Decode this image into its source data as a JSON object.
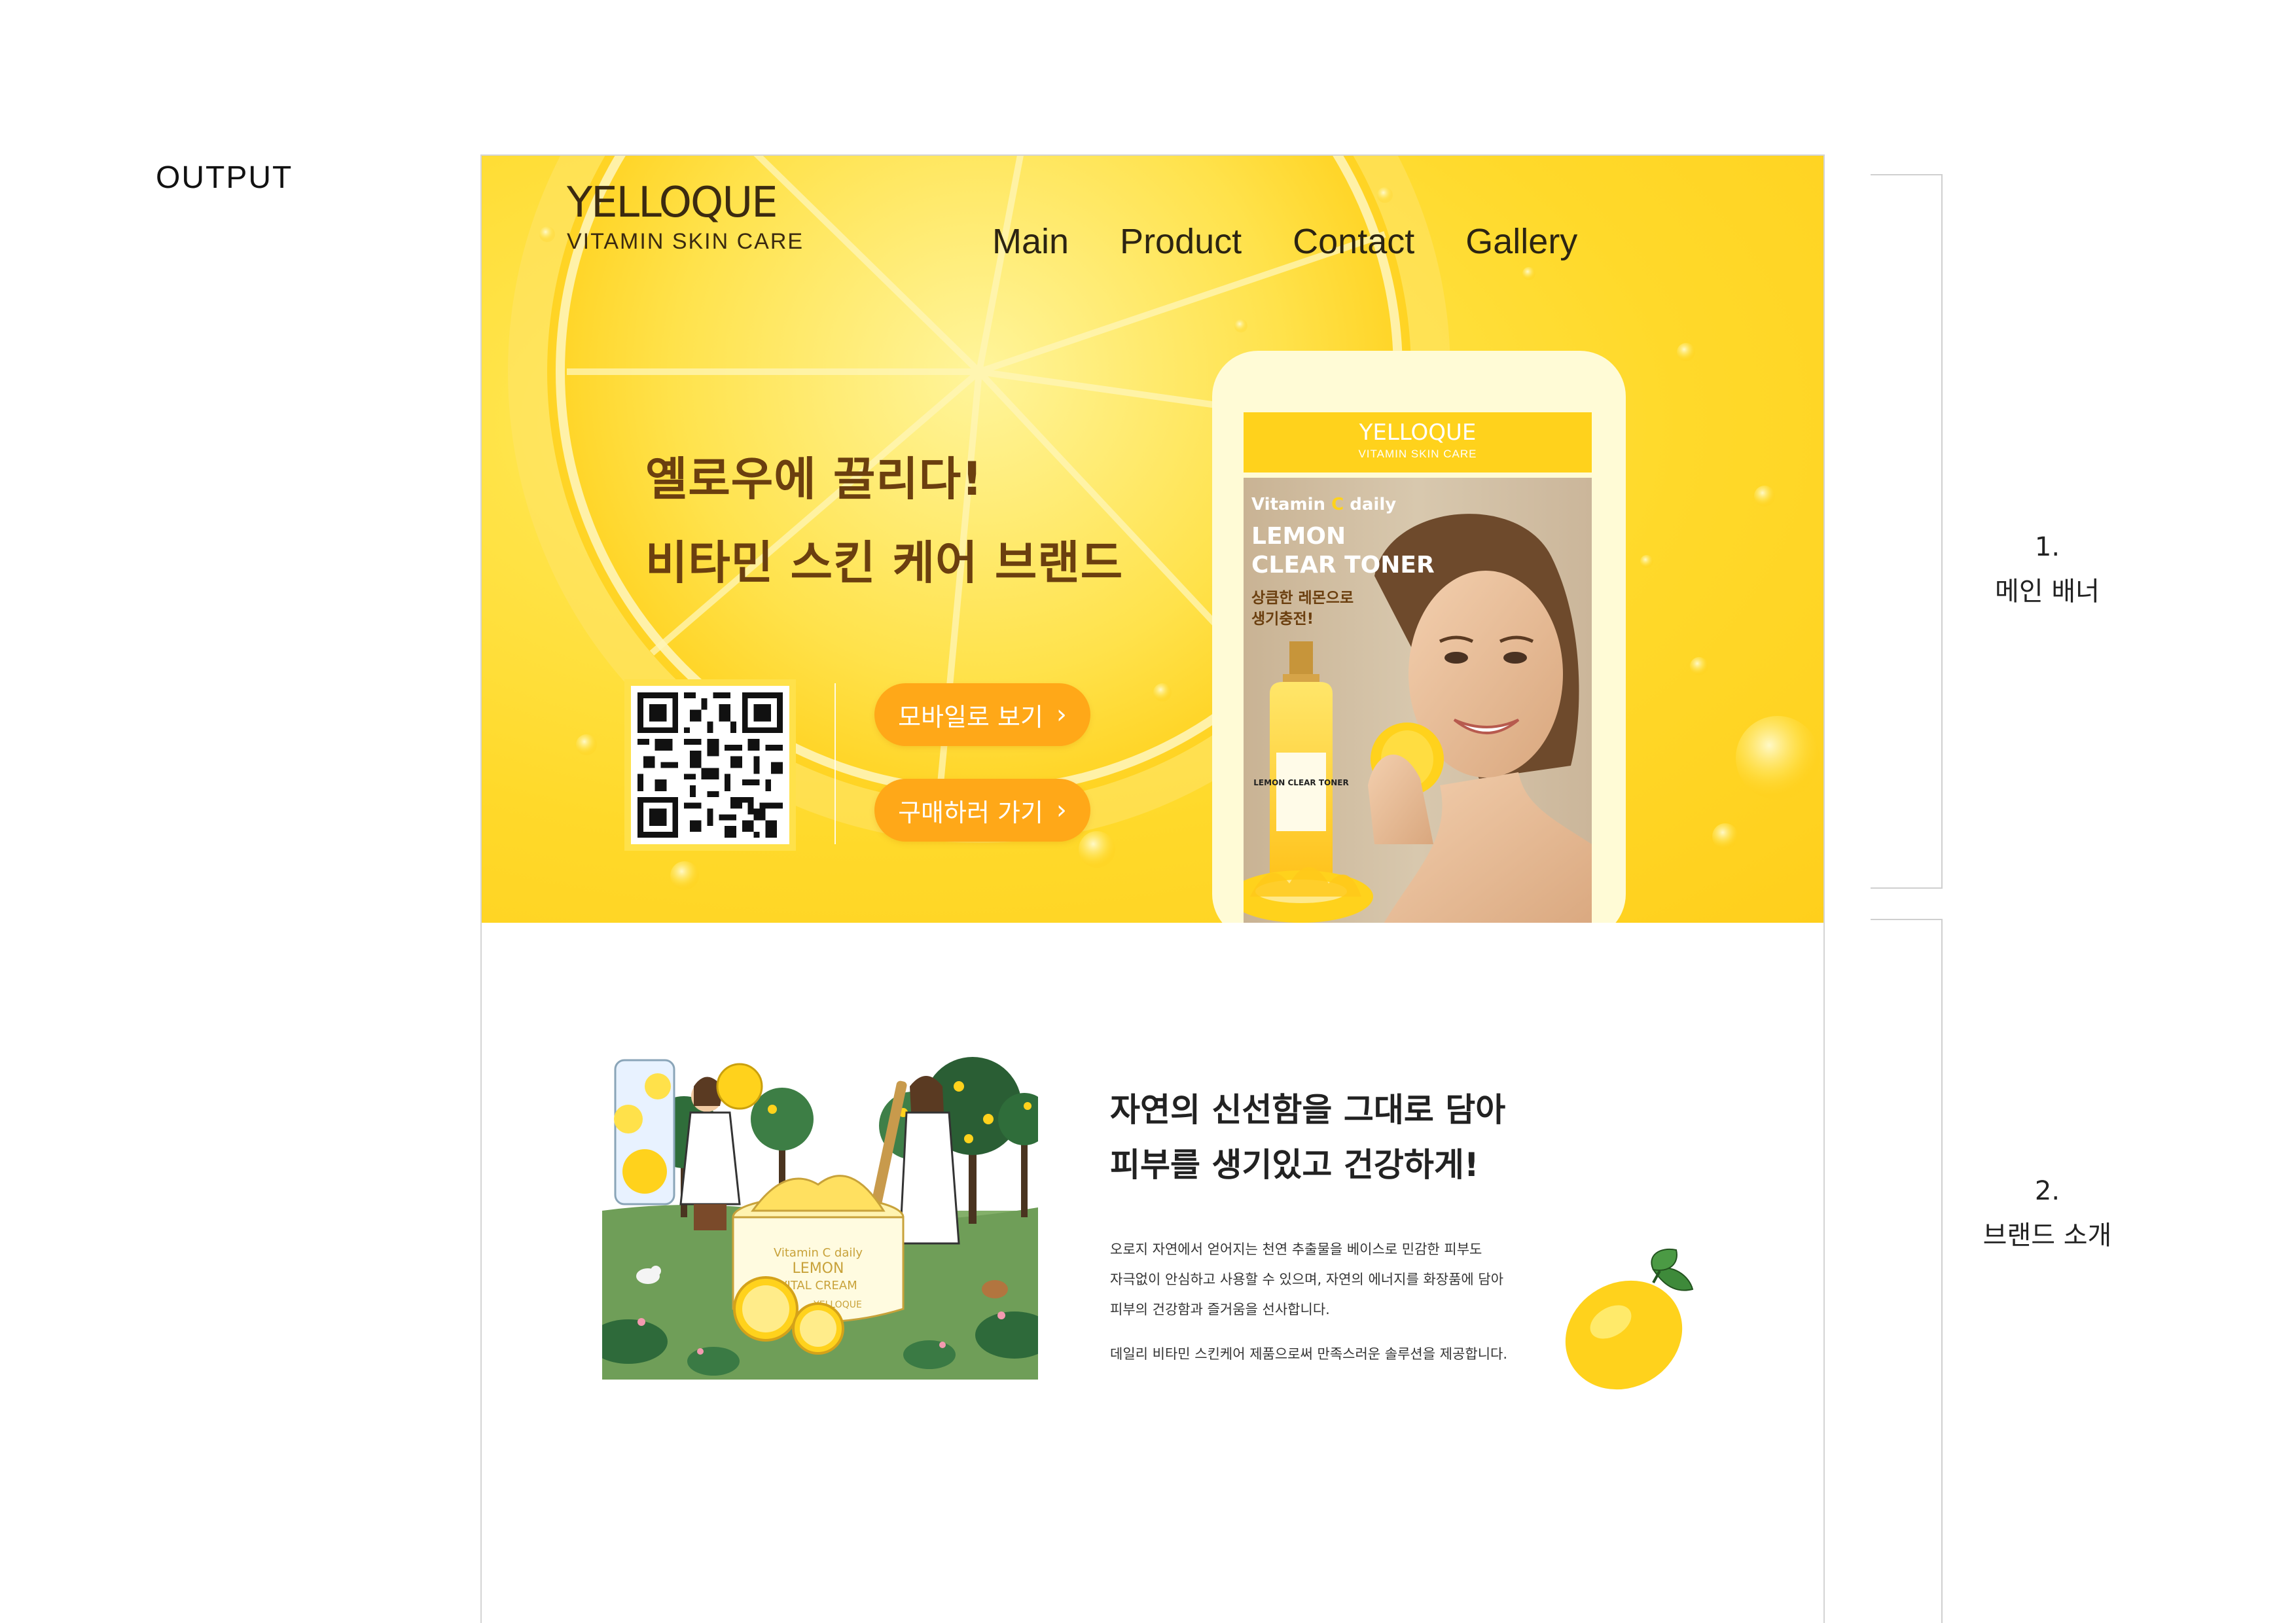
{
  "page_label": "OUTPUT",
  "header": {
    "logo_main": "YELLOQUE",
    "logo_sub": "VITAMIN SKIN CARE",
    "nav": [
      "Main",
      "Product",
      "Contact",
      "Gallery"
    ]
  },
  "hero": {
    "headline_1": "옐로우에 끌리다!",
    "headline_2": "비타민 스킨 케어 브랜드",
    "btn_mobile": "모바일로 보기",
    "btn_buy": "구매하러 가기"
  },
  "phone": {
    "logo_main": "YELLOQUE",
    "logo_sub": "VITAMIN SKIN CARE",
    "ad_vitamin": "Vitamin ",
    "ad_c": "C",
    "ad_daily": " daily",
    "ad_title_1": "LEMON",
    "ad_title_2": "CLEAR TONER",
    "ad_copy_1": "상큼한 레몬으로",
    "ad_copy_2": "생기충전!",
    "bottle_label": "LEMON CLEAR TONER"
  },
  "illustration": {
    "jar_line_1": "Vitamin C daily",
    "jar_line_2": "LEMON",
    "jar_line_3": "VITAL CREAM",
    "jar_brand": "YELLOQUE"
  },
  "brand": {
    "title_1": "자연의 신선함을 그대로 담아",
    "title_2": "피부를 생기있고 건강하게!",
    "body_1": "오로지 자연에서 얻어지는 천연 추출물을 베이스로 민감한 피부도",
    "body_2": "자극없이 안심하고 사용할 수 있으며, 자연의 에너지를 화장품에 담아",
    "body_3": "피부의 건강함과 즐거움을 선사합니다.",
    "body_4": "데일리 비타민 스킨케어 제품으로써 만족스러운 솔루션을 제공합니다."
  },
  "annotations": {
    "section1_num": "1.",
    "section1_name": "메인 배너",
    "section2_num": "2.",
    "section2_name": "브랜드 소개"
  },
  "colors": {
    "banner_yellow": "#ffd92a",
    "button_orange": "#ffa818",
    "headline_brown": "#6b3f0f",
    "phone_header": "#ffd21c"
  },
  "icons": [
    "qr-code-icon",
    "chevron-right-icon",
    "lemon-icon"
  ]
}
